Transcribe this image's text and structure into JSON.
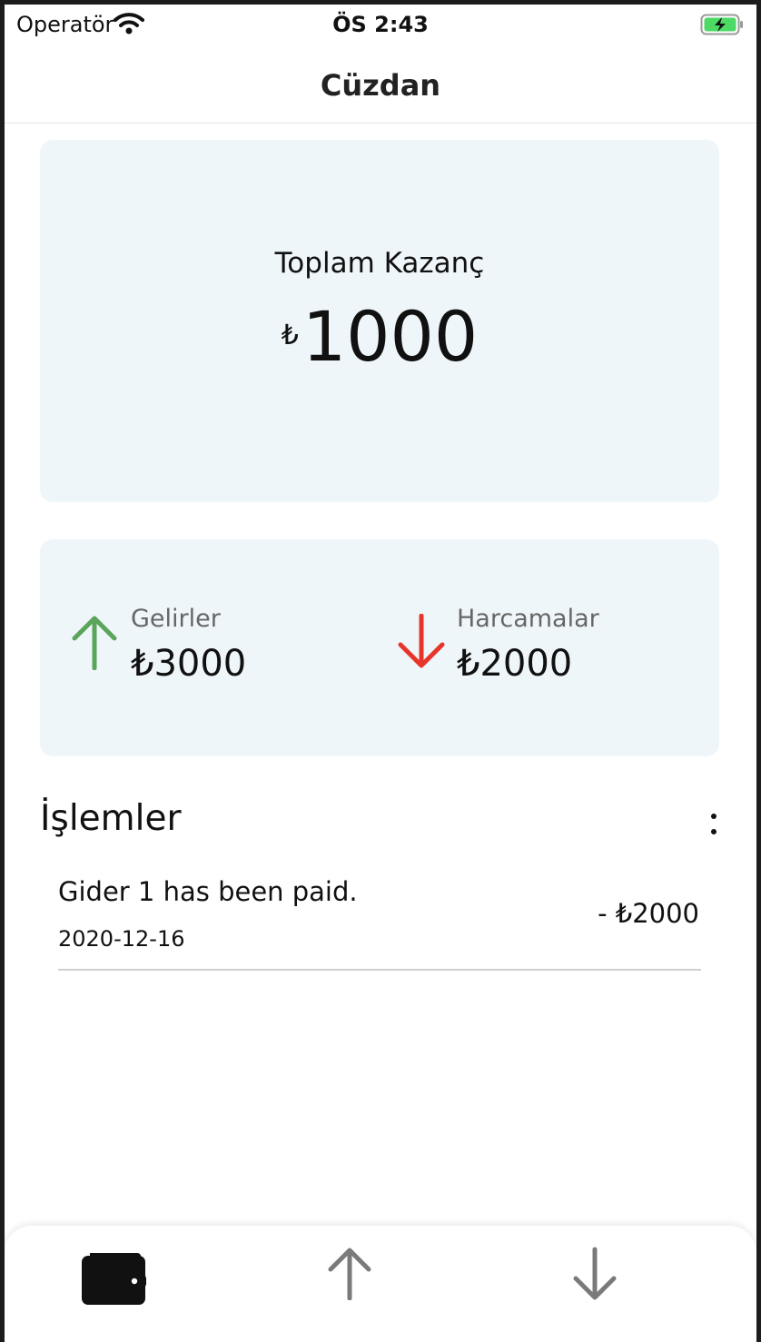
{
  "status_bar": {
    "carrier": "Operatör",
    "time": "ÖS 2:43",
    "icons": [
      "wifi-icon",
      "battery-charging-icon"
    ]
  },
  "nav": {
    "title": "Cüzdan"
  },
  "balance": {
    "label": "Toplam Kazanç",
    "currency": "₺",
    "amount": "1000"
  },
  "summary": {
    "income": {
      "label": "Gelirler",
      "value": "₺3000",
      "icon": "arrow-up-icon",
      "color": "#5aa55a"
    },
    "expense": {
      "label": "Harcamalar",
      "value": "₺2000",
      "icon": "arrow-down-icon",
      "color": "#e8352c"
    }
  },
  "transactions": {
    "title": "İşlemler",
    "items": [
      {
        "description": "Gider 1 has been paid.",
        "date": "2020-12-16",
        "amount": "- ₺2000"
      }
    ]
  },
  "tab_bar": {
    "tabs": [
      {
        "name": "wallet",
        "icon": "wallet-icon",
        "active": true
      },
      {
        "name": "income",
        "icon": "arrow-up-icon",
        "active": false
      },
      {
        "name": "expense",
        "icon": "arrow-down-icon",
        "active": false
      }
    ]
  },
  "colors": {
    "card_background": "#eff6fa",
    "income_accent": "#5aa55a",
    "expense_accent": "#e8352c",
    "tab_inactive": "#7a7a7a"
  }
}
